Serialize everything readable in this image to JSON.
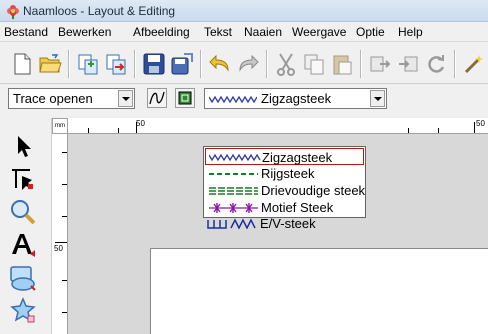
{
  "window": {
    "title": "Naamloos - Layout & Editing"
  },
  "menu": {
    "items": [
      "Bestand",
      "Bewerken",
      "Afbeelding",
      "Tekst",
      "Naaien",
      "Weergave",
      "Optie",
      "Help"
    ]
  },
  "toolbar": {
    "icons": [
      "new-document-icon",
      "open-folder-icon",
      "import-icon",
      "export-icon",
      "save-icon",
      "save-as-icon",
      "undo-icon",
      "redo-icon",
      "cut-icon",
      "copy-icon",
      "paste-icon",
      "send-icon",
      "receive-icon",
      "rotate-icon",
      "wizard-icon"
    ]
  },
  "toolbar2": {
    "trace_combo_value": "Trace openen",
    "stitch_combo_value": "Zigzagsteek"
  },
  "ruler": {
    "unit_label": "mm",
    "h_labels": [
      "50",
      "50"
    ],
    "v_label": "50"
  },
  "dropdown": {
    "items": [
      {
        "label": "Zigzagsteek",
        "style": "zigzag",
        "color": "#2d3aa6"
      },
      {
        "label": "Rijgsteek",
        "style": "dashed",
        "color": "#1a7a2a"
      },
      {
        "label": "Drievoudige steek",
        "style": "triple",
        "color": "#1a7a2a"
      },
      {
        "label": "Motief Steek",
        "style": "motif",
        "color": "#8a1aa6"
      },
      {
        "label": "E/V-steek",
        "style": "ev",
        "color": "#1c2f9a"
      }
    ],
    "selected_index": 0
  },
  "colors": {
    "selection_border": "#b31818",
    "title_gradient_top": "#dfe9f6",
    "workspace": "#d8d8d8"
  }
}
